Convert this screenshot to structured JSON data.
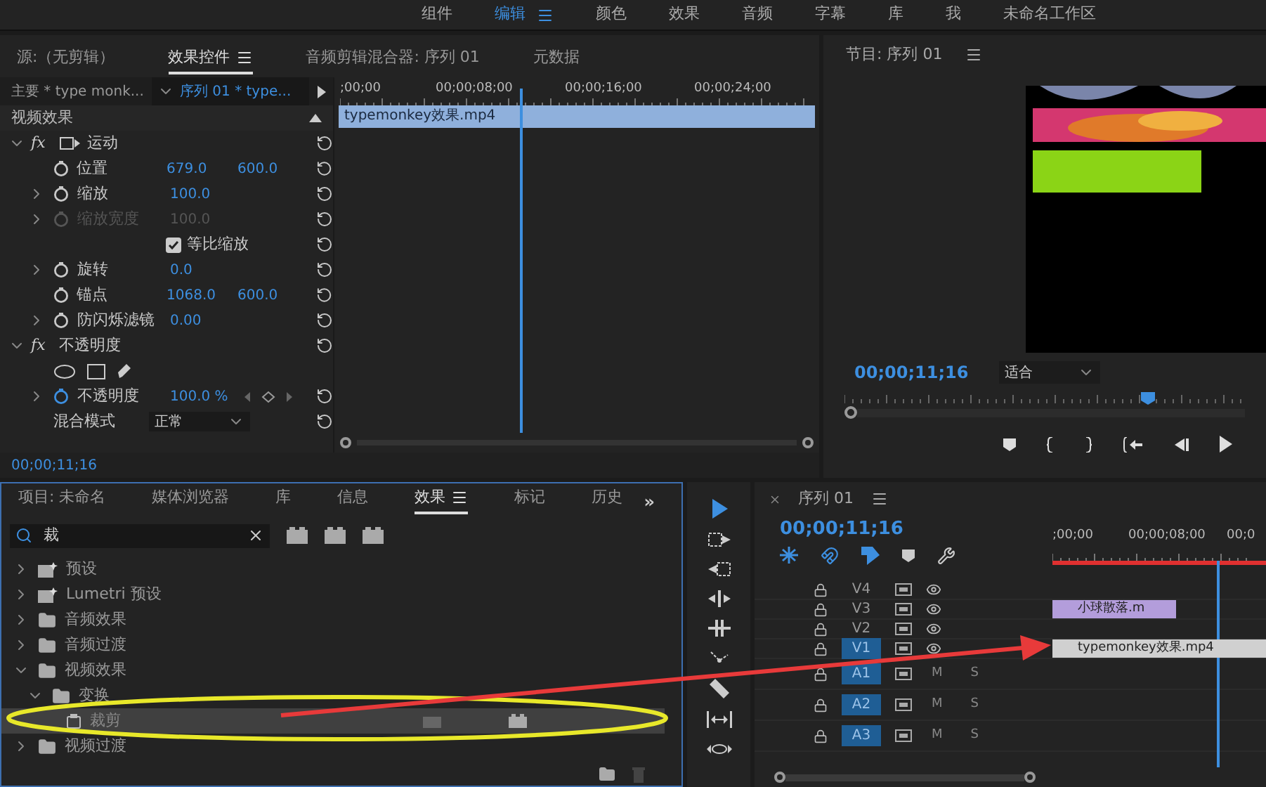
{
  "workspace_tabs": [
    {
      "label": "组件",
      "selected": false
    },
    {
      "label": "编辑",
      "selected": true
    },
    {
      "label": "颜色",
      "selected": false
    },
    {
      "label": "效果",
      "selected": false
    },
    {
      "label": "音频",
      "selected": false
    },
    {
      "label": "字幕",
      "selected": false
    },
    {
      "label": "库",
      "selected": false
    },
    {
      "label": "我",
      "selected": false
    },
    {
      "label": "未命名工作区",
      "selected": false
    }
  ],
  "effect_controls": {
    "tabs": [
      {
        "label": "源:（无剪辑）",
        "selected": false
      },
      {
        "label": "效果控件",
        "selected": true
      },
      {
        "label": "音频剪辑混合器: 序列 01",
        "selected": false
      },
      {
        "label": "元数据",
        "selected": false
      }
    ],
    "master_clip": "主要 * type monk...",
    "sequence_clip": "序列 01 * type...",
    "ruler": [
      ";00;00",
      "00;00;08;00",
      "00;00;16;00",
      "00;00;24;00"
    ],
    "clip": "typemonkey效果.mp4",
    "section": "视频效果",
    "rows": [
      {
        "kind": "effect",
        "badge": "fx",
        "label": "运动",
        "expanded": true
      },
      {
        "kind": "param",
        "label": "位置",
        "values": [
          "679.0",
          "600.0"
        ],
        "disabled": false,
        "animated": false
      },
      {
        "kind": "param",
        "label": "缩放",
        "values": [
          "100.0"
        ],
        "expanded": false,
        "disabled": false,
        "animated": false
      },
      {
        "kind": "param",
        "label": "缩放宽度",
        "values": [
          "100.0"
        ],
        "expanded": false,
        "disabled": true,
        "animated": false
      },
      {
        "kind": "checkbox",
        "label": "等比缩放",
        "checked": true
      },
      {
        "kind": "param",
        "label": "旋转",
        "values": [
          "0.0"
        ],
        "expanded": false,
        "disabled": false,
        "animated": false
      },
      {
        "kind": "param",
        "label": "锚点",
        "values": [
          "1068.0",
          "600.0"
        ],
        "disabled": false,
        "animated": false
      },
      {
        "kind": "param",
        "label": "防闪烁滤镜",
        "values": [
          "0.00"
        ],
        "expanded": false,
        "disabled": false,
        "animated": false
      },
      {
        "kind": "effect",
        "badge": "fx",
        "label": "不透明度",
        "expanded": true
      },
      {
        "kind": "masks"
      },
      {
        "kind": "param",
        "label": "不透明度",
        "values": [
          "100.0 %"
        ],
        "expanded": false,
        "disabled": false,
        "animated": true
      },
      {
        "kind": "dropdown",
        "label": "混合模式",
        "value": "正常"
      }
    ],
    "timecode": "00;00;11;16"
  },
  "program": {
    "title": "节目: 序列 01",
    "timecode": "00;00;11;16",
    "zoom": "适合"
  },
  "project": {
    "tabs": [
      {
        "label": "项目: 未命名",
        "selected": false
      },
      {
        "label": "媒体浏览器",
        "selected": false
      },
      {
        "label": "库",
        "selected": false
      },
      {
        "label": "信息",
        "selected": false
      },
      {
        "label": "效果",
        "selected": true
      },
      {
        "label": "标记",
        "selected": false
      },
      {
        "label": "历史",
        "selected": false
      }
    ],
    "overflow": "»",
    "search": "裁",
    "tree": [
      {
        "label": "预设",
        "kind": "preset",
        "expanded": false,
        "selected": false
      },
      {
        "label": "Lumetri 预设",
        "kind": "preset",
        "expanded": false,
        "selected": false
      },
      {
        "label": "音频效果",
        "kind": "folder",
        "expanded": false,
        "selected": false
      },
      {
        "label": "音频过渡",
        "kind": "folder",
        "expanded": false,
        "selected": false
      },
      {
        "label": "视频效果",
        "kind": "folder",
        "expanded": true,
        "selected": false,
        "children": [
          {
            "label": "变换",
            "kind": "folder",
            "expanded": true,
            "selected": false,
            "children": [
              {
                "label": "裁剪",
                "kind": "effect",
                "selected": true
              }
            ]
          }
        ]
      },
      {
        "label": "视频过渡",
        "kind": "folder",
        "expanded": false,
        "selected": false
      }
    ]
  },
  "timeline": {
    "title": "序列 01",
    "timecode": "00;00;11;16",
    "ruler": [
      ";00;00",
      "00;00;08;00",
      "00;0"
    ],
    "tracks": [
      {
        "name": "V4",
        "kind": "video",
        "targeted": false
      },
      {
        "name": "V3",
        "kind": "video",
        "targeted": false,
        "clip": {
          "label": "小球散落.m",
          "color": "#b39ddb"
        }
      },
      {
        "name": "V2",
        "kind": "video",
        "targeted": false
      },
      {
        "name": "V1",
        "kind": "video",
        "targeted": true,
        "clip": {
          "label": "typemonkey效果.mp4",
          "color": "#d0d0d0"
        }
      },
      {
        "name": "A1",
        "kind": "audio",
        "targeted": true,
        "mute": "M",
        "solo": "S"
      },
      {
        "name": "A2",
        "kind": "audio",
        "targeted": true,
        "mute": "M",
        "solo": "S"
      },
      {
        "name": "A3",
        "kind": "audio",
        "targeted": true,
        "mute": "M",
        "solo": "S"
      }
    ]
  }
}
